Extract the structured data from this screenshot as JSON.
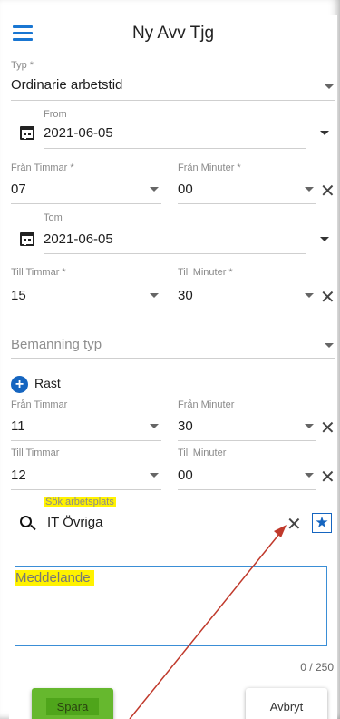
{
  "header": {
    "title": "Ny Avv Tjg"
  },
  "typ": {
    "label": "Typ *",
    "value": "Ordinarie arbetstid"
  },
  "from": {
    "label": "From",
    "date": "2021-06-05"
  },
  "fran_timmar": {
    "label": "Från Timmar *",
    "value": "07"
  },
  "fran_minuter": {
    "label": "Från Minuter *",
    "value": "00"
  },
  "tom": {
    "label": "Tom",
    "date": "2021-06-05"
  },
  "till_timmar": {
    "label": "Till Timmar *",
    "value": "15"
  },
  "till_minuter": {
    "label": "Till Minuter *",
    "value": "30"
  },
  "bemanning": {
    "placeholder": "Bemanning typ"
  },
  "rast": {
    "label": "Rast",
    "fran_timmar": {
      "label": "Från Timmar",
      "value": "11"
    },
    "fran_minuter": {
      "label": "Från Minuter",
      "value": "30"
    },
    "till_timmar": {
      "label": "Till Timmar",
      "value": "12"
    },
    "till_minuter": {
      "label": "Till Minuter",
      "value": "00"
    }
  },
  "arbetsplats": {
    "label": "Sök arbetsplats",
    "value": "IT Övriga"
  },
  "meddelande": {
    "placeholder": "Meddelande",
    "counter": "0 / 250"
  },
  "buttons": {
    "save": "Spara",
    "cancel": "Avbryt"
  },
  "colors": {
    "accent": "#1565c0",
    "save": "#66b82e",
    "highlight": "#fff200",
    "arrow": "#c0392b"
  },
  "icons": [
    "menu-icon",
    "calendar-icon",
    "chevron-down-icon",
    "close-icon",
    "add-circle-icon",
    "search-icon",
    "star-icon"
  ]
}
